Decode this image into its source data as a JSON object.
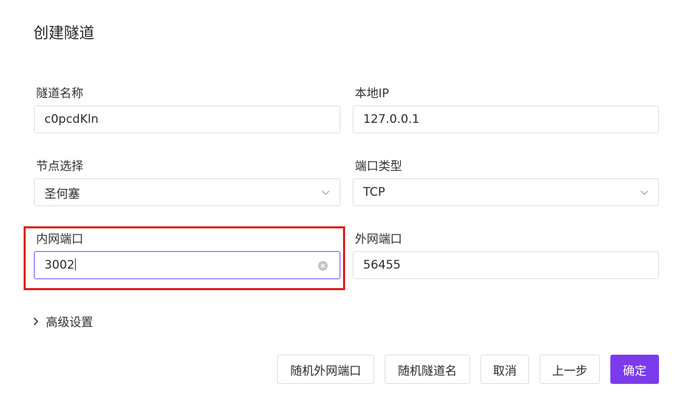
{
  "dialog": {
    "title": "创建隧道"
  },
  "form": {
    "tunnel_name": {
      "label": "隧道名称",
      "value": "c0pcdKln"
    },
    "local_ip": {
      "label": "本地IP",
      "value": "127.0.0.1"
    },
    "node": {
      "label": "节点选择",
      "value": "圣何塞"
    },
    "port_type": {
      "label": "端口类型",
      "value": "TCP"
    },
    "internal_port": {
      "label": "内网端口",
      "value": "3002"
    },
    "external_port": {
      "label": "外网端口",
      "value": "56455"
    }
  },
  "advanced": {
    "label": "高级设置"
  },
  "buttons": {
    "random_external_port": "随机外网端口",
    "random_tunnel_name": "随机隧道名",
    "cancel": "取消",
    "previous": "上一步",
    "confirm": "确定"
  },
  "colors": {
    "primary": "#7c3aed",
    "highlight_box": "#e11d1d"
  }
}
